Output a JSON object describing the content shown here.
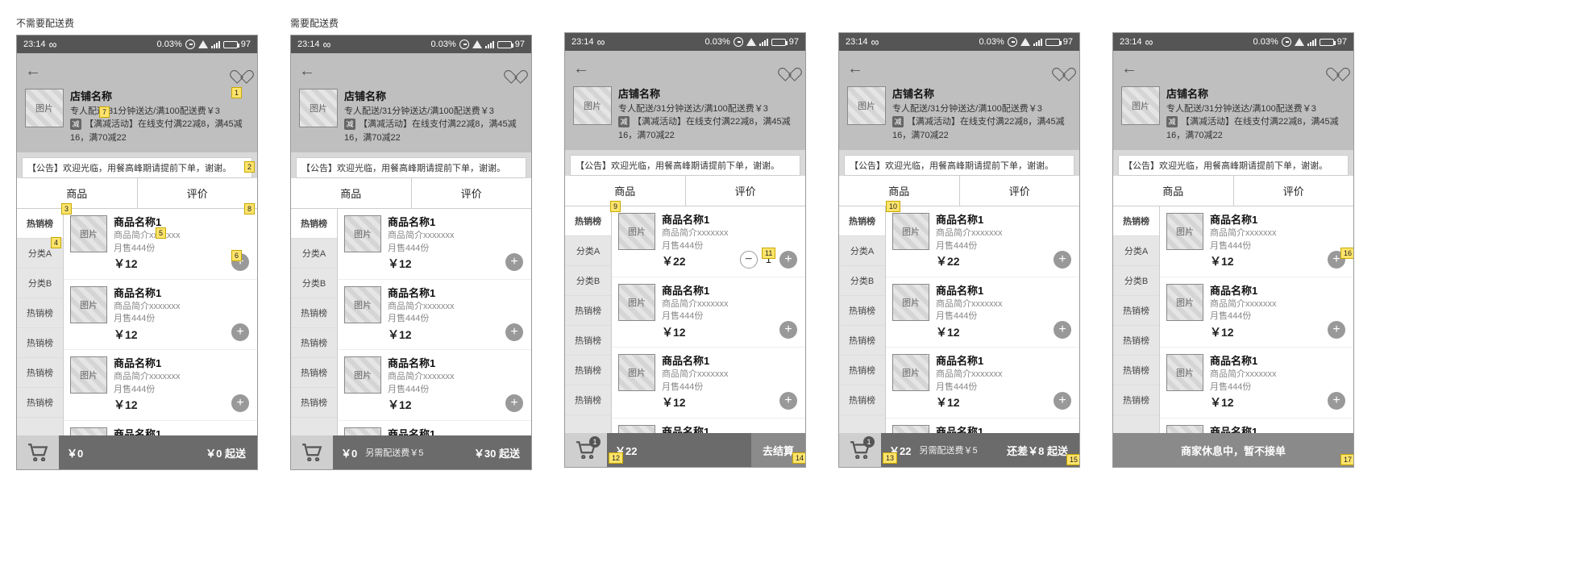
{
  "frames": [
    {
      "title": "不需要配送费",
      "cartMode": "noship_empty",
      "firstPrice": "￥12",
      "firstStepper": false,
      "cartBadge": null,
      "notes": [
        [
          266,
          64,
          "1"
        ],
        [
          282,
          156,
          "2"
        ],
        [
          102,
          88,
          "7"
        ],
        [
          55,
          208,
          "3"
        ],
        [
          42,
          250,
          "4"
        ],
        [
          172,
          238,
          "5"
        ],
        [
          266,
          266,
          "6"
        ],
        [
          282,
          208,
          "8"
        ]
      ]
    },
    {
      "title": "需要配送费",
      "cartMode": "ship_empty",
      "firstPrice": "￥12",
      "firstStepper": false,
      "cartBadge": null,
      "notes": []
    },
    {
      "title": "",
      "cartMode": "checkout",
      "firstPrice": "￥22",
      "firstStepper": true,
      "cartBadge": "1",
      "notes": [
        [
          56,
          208,
          "9"
        ],
        [
          244,
          266,
          "11"
        ],
        [
          54,
          520,
          "12"
        ],
        [
          282,
          520,
          "14"
        ]
      ]
    },
    {
      "title": "",
      "cartMode": "ship_need",
      "firstPrice": "￥22",
      "firstStepper": false,
      "cartBadge": "1",
      "notes": [
        [
          58,
          208,
          "10"
        ],
        [
          54,
          520,
          "13"
        ],
        [
          282,
          522,
          "15"
        ]
      ]
    },
    {
      "title": "",
      "cartMode": "closed",
      "firstPrice": "￥12",
      "firstStepper": false,
      "cartBadge": null,
      "notes": [
        [
          282,
          266,
          "16"
        ],
        [
          282,
          522,
          "17"
        ]
      ]
    }
  ],
  "status": {
    "time": "23:14",
    "pct": "0.03%",
    "batt": "97"
  },
  "shop": {
    "name": "店铺名称",
    "delivery": "专人配送/31分钟送达/满100配送费￥3",
    "promo": "【满减活动】在线支付满22减8，满45减16，满70减22",
    "jian": "减",
    "thumb": "图片"
  },
  "notice": "【公告】欢迎光临，用餐高峰期请提前下单，谢谢。",
  "tabs": {
    "goods": "商品",
    "review": "评价"
  },
  "cats": [
    "热销榜",
    "分类A",
    "分类B",
    "热销榜",
    "热销榜",
    "热销榜",
    "热销榜"
  ],
  "good": {
    "name": "商品名称1",
    "desc": "商品简介xxxxxxx",
    "sold": "月售444份",
    "price": "￥12",
    "thumb": "图片"
  },
  "cart": {
    "empty_price": "￥0",
    "empty_right_noship": "￥0  起送",
    "ship_empty_mid": "另需配送费￥5",
    "ship_empty_right": "￥30  起送",
    "checkout_price": "￥22",
    "checkout_right": "去结算",
    "ship_need_price": "￥22",
    "ship_need_mid": "另需配送费￥5",
    "ship_need_right": "还差￥8 起送",
    "closed": "商家休息中，暂不接单"
  },
  "stepperVal": "1"
}
